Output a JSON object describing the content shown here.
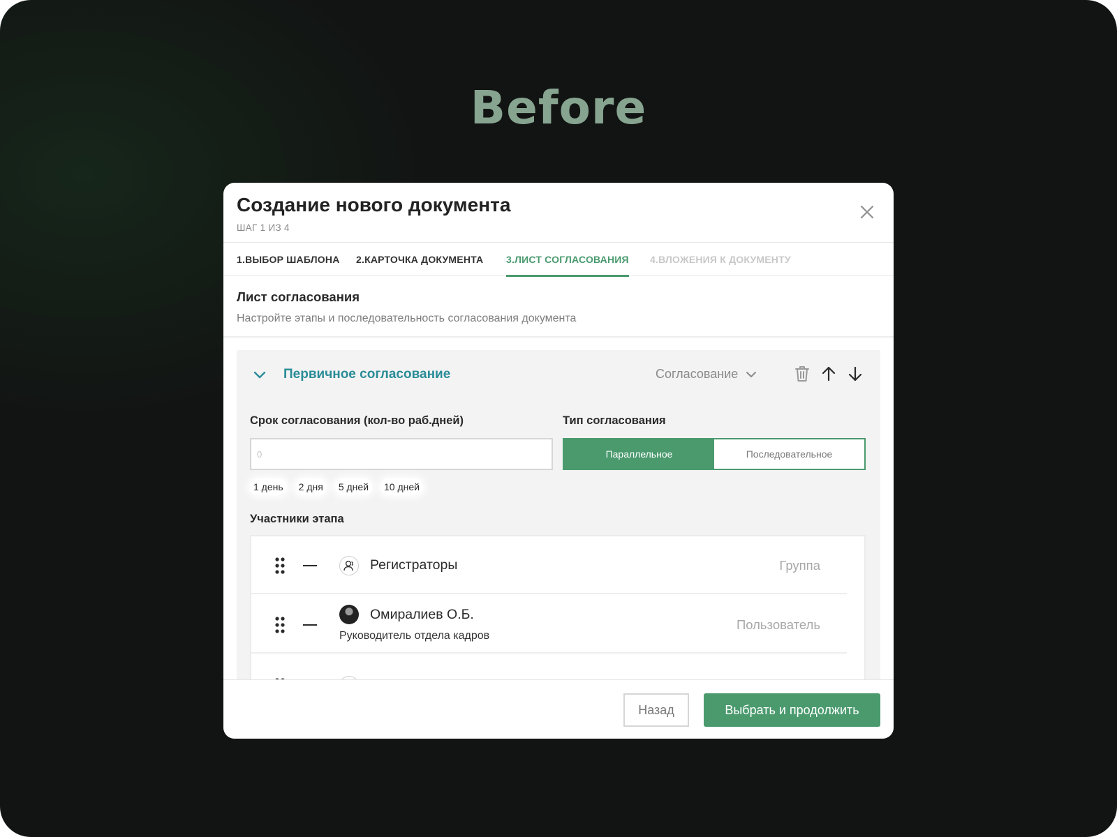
{
  "hero": {
    "title": "Before"
  },
  "modal": {
    "title": "Создание нового документа",
    "step": "ШАГ 1 ИЗ 4",
    "close_icon": "close-icon"
  },
  "tabs": [
    {
      "label": "1.ВЫБОР ШАБЛОНА",
      "state": "done"
    },
    {
      "label": "2.КАРТОЧКА ДОКУМЕНТА",
      "state": "done"
    },
    {
      "label": "3.ЛИСТ СОГЛАСОВАНИЯ",
      "state": "active"
    },
    {
      "label": "4.ВЛОЖЕНИЯ К ДОКУМЕНТУ",
      "state": "disabled"
    }
  ],
  "section": {
    "title": "Лист согласования",
    "subtitle": "Настройте этапы и последовательность согласования документа"
  },
  "stage": {
    "title": "Первичное согласование",
    "type_select": "Согласование",
    "term_label": "Срок согласования (кол-во раб.дней)",
    "term_placeholder": "0",
    "term_chips": [
      "1 день",
      "2 дня",
      "5 дней",
      "10 дней"
    ],
    "approval_type_label": "Тип согласования",
    "approval_types": [
      {
        "label": "Параллельное",
        "selected": true
      },
      {
        "label": "Последовательное",
        "selected": false
      }
    ],
    "participants_label": "Участники этапа",
    "participants": [
      {
        "name": "Регистраторы",
        "role": "",
        "type": "Группа",
        "avatar": "group-icon"
      },
      {
        "name": "Омиралиев О.Б.",
        "role": "Руководитель отдела кадров",
        "type": "Пользователь",
        "avatar": "user-photo"
      }
    ]
  },
  "footer": {
    "back_label": "Назад",
    "next_label": "Выбрать и продолжить"
  },
  "colors": {
    "accent": "#4a9a6e",
    "stage_title": "#2a8c97",
    "hero_title": "#86a48f",
    "background": "#131413"
  }
}
